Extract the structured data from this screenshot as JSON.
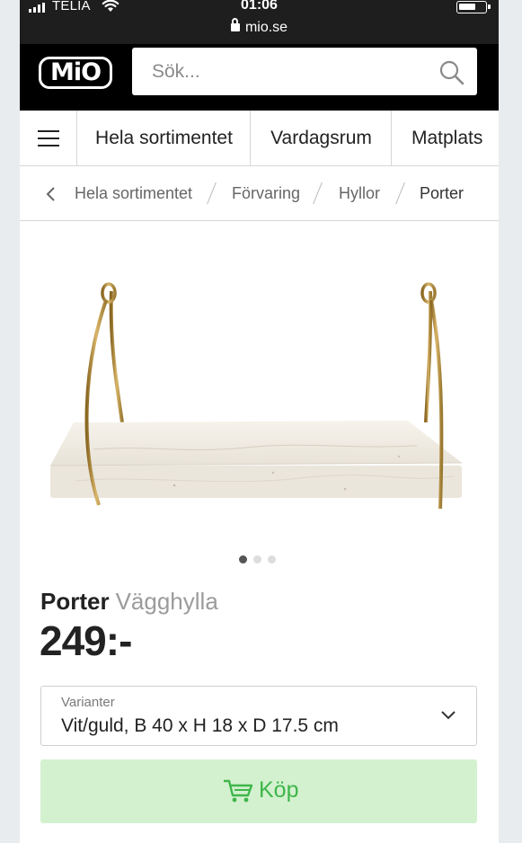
{
  "status_bar": {
    "carrier": "TELIA",
    "time": "01:06",
    "url": "mio.se"
  },
  "header": {
    "logo": "MiO",
    "search_placeholder": "Sök..."
  },
  "nav": {
    "categories": [
      "Hela sortimentet",
      "Vardagsrum",
      "Matplats"
    ]
  },
  "breadcrumb": {
    "items": [
      "Hela sortimentet",
      "Förvaring",
      "Hyllor",
      "Porter"
    ]
  },
  "product": {
    "brand": "Porter",
    "type": "Vägghylla",
    "price": "249:-",
    "image_count": 3,
    "active_image": 1,
    "variant_label": "Varianter",
    "variant_value": "Vit/guld, B 40 x H 18 x D 17.5 cm",
    "buy_label": "Köp"
  },
  "colors": {
    "accent_green": "#3fb64a",
    "buy_bg": "#d3f1cf",
    "header_bg": "#000000",
    "brass": "#b8923e",
    "marble": "#efebe2"
  }
}
